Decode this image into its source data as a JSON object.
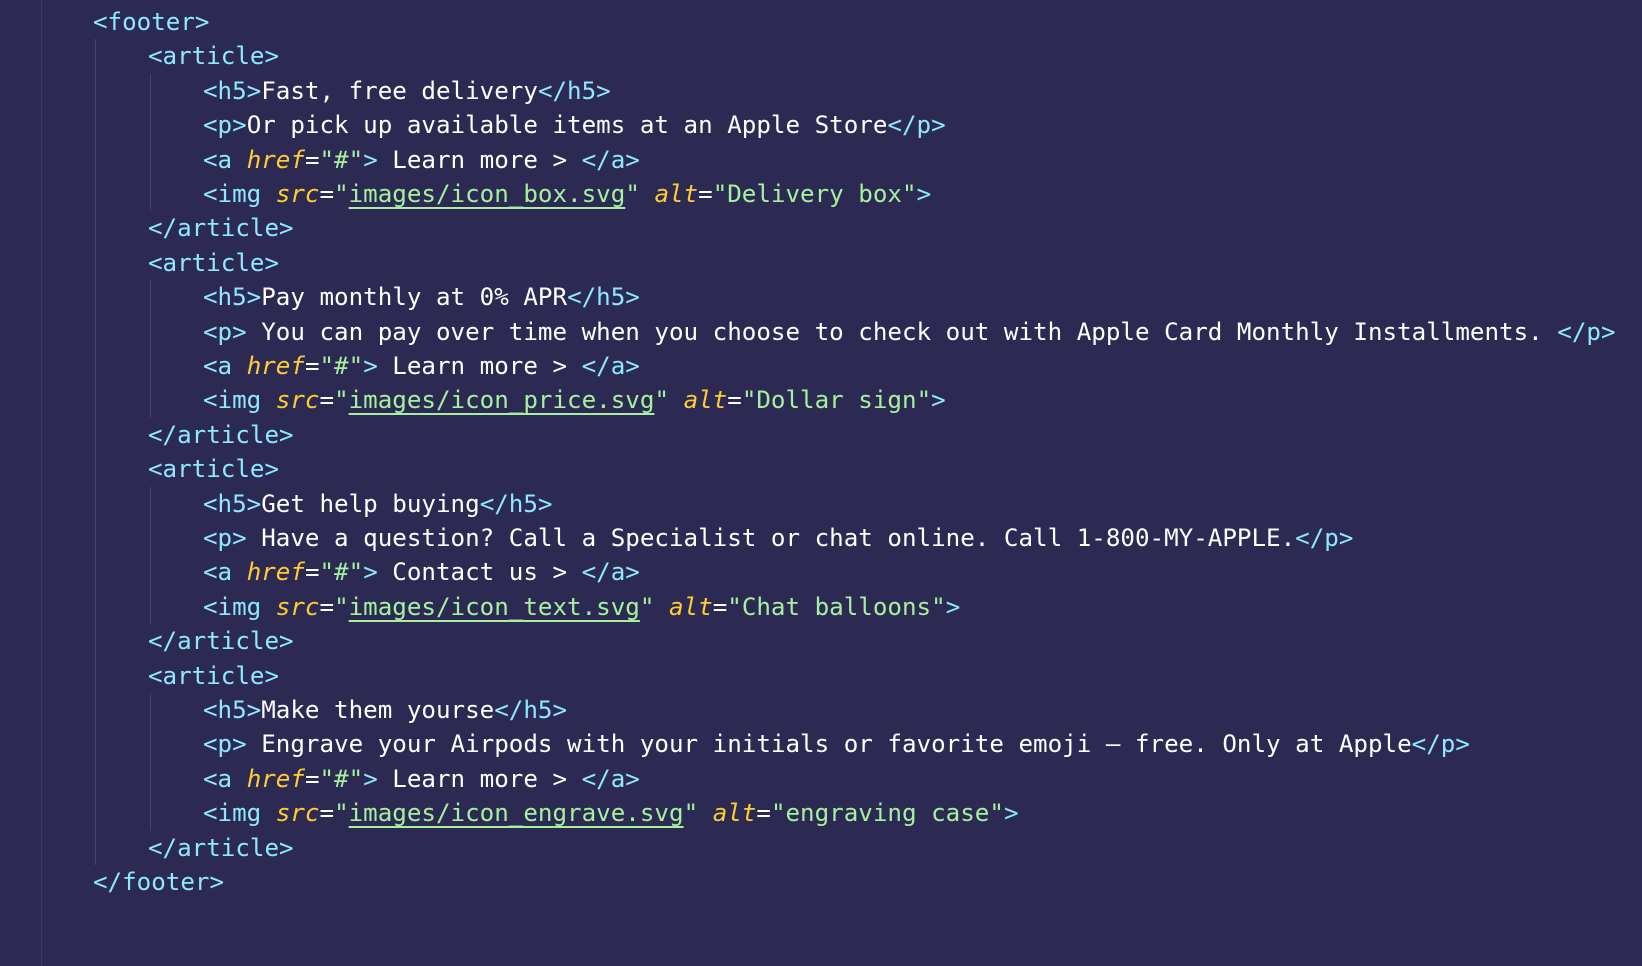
{
  "footer": {
    "open_tag": "<footer>",
    "close_tag": "</footer>"
  },
  "articles": [
    {
      "open_tag": "<article>",
      "close_tag": "</article>",
      "heading": "Fast, free delivery",
      "heading_pad": "",
      "paragraph": "Or pick up available items at an Apple Store",
      "paragraph_pad": "",
      "link_text": " Learn more > ",
      "img_src": "images/icon_box.svg",
      "img_alt": "Delivery box"
    },
    {
      "open_tag": "<article>",
      "close_tag": "</article>",
      "heading": "Pay monthly at 0% APR",
      "paragraph": " You can pay over time when you choose to check out with Apple Card Monthly Installments. ",
      "link_text": " Learn more > ",
      "img_src": "images/icon_price.svg",
      "img_alt": "Dollar sign"
    },
    {
      "open_tag": "<article>",
      "close_tag": "</article>",
      "heading": "Get help buying",
      "paragraph": " Have a question? Call a Specialist or chat online. Call 1-800-MY-APPLE.",
      "link_text": " Contact us > ",
      "img_src": "images/icon_text.svg",
      "img_alt": "Chat balloons"
    },
    {
      "open_tag": "<article>",
      "close_tag": "</article>",
      "heading": "Make them yourse",
      "paragraph": " Engrave your Airpods with your initials or favorite emoji – free. Only at Apple",
      "link_text": " Learn more > ",
      "img_src": "images/icon_engrave.svg",
      "img_alt": "engraving case"
    }
  ],
  "tokens": {
    "h5_open": "<h5>",
    "h5_close": "</h5>",
    "p_open": "<p>",
    "p_close": "</p>",
    "a_open": "<a ",
    "a_close": "</a>",
    "href_attr": "href",
    "href_value": "\"#\"",
    "img_open": "<img ",
    "src_attr": "src",
    "alt_attr": "alt",
    "equals": "=",
    "quote": "\"",
    "tag_end": ">",
    "space": " "
  },
  "colors": {
    "background": "#2c2a52",
    "tag": "#8ee8ff",
    "attribute": "#ffcc33",
    "string": "#a6f0a0",
    "text": "#ffffff"
  }
}
